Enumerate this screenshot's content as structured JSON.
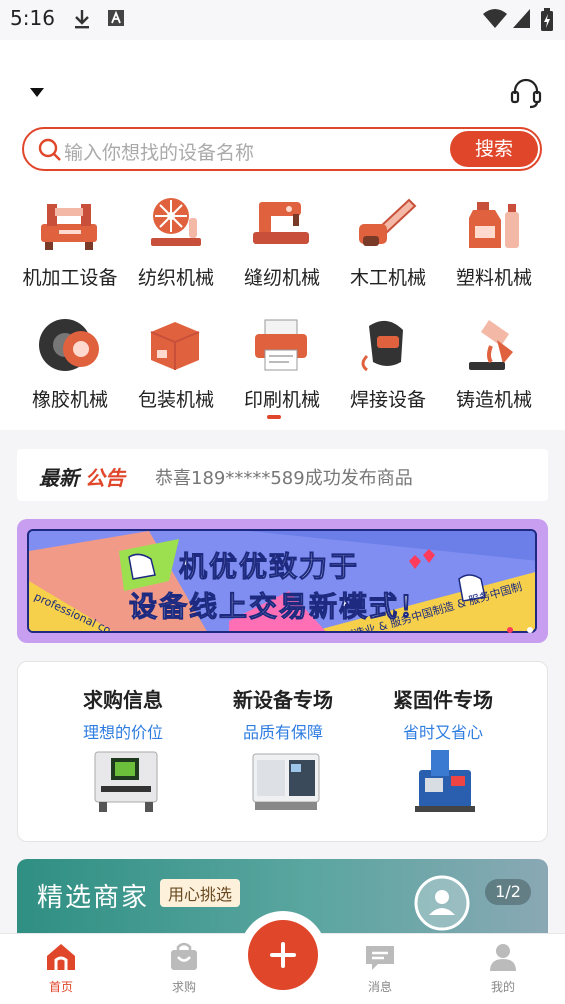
{
  "status_bar": {
    "time": "5:16"
  },
  "search": {
    "placeholder": "输入你想找的设备名称",
    "button_label": "搜索"
  },
  "categories": [
    {
      "label": "机加工设备",
      "icon": "lathe-icon"
    },
    {
      "label": "纺织机械",
      "icon": "textile-icon"
    },
    {
      "label": "缝纫机械",
      "icon": "sewing-machine-icon"
    },
    {
      "label": "木工机械",
      "icon": "chainsaw-icon"
    },
    {
      "label": "塑料机械",
      "icon": "plastic-bottles-icon"
    },
    {
      "label": "橡胶机械",
      "icon": "tire-icon"
    },
    {
      "label": "包装机械",
      "icon": "package-icon"
    },
    {
      "label": "印刷机械",
      "icon": "printer-icon"
    },
    {
      "label": "焊接设备",
      "icon": "welding-mask-icon"
    },
    {
      "label": "铸造机械",
      "icon": "casting-ladle-icon"
    }
  ],
  "notice": {
    "title_part1": "最新",
    "title_part2": "公告",
    "message": "恭喜189*****589成功发布商品"
  },
  "banner": {
    "line1": "机优优致力于",
    "line2": "设备线上交易新模式！",
    "side_text_left": "professional co",
    "side_text_right": "国制造业 & 服务中国制造 & 服务中国制"
  },
  "specials": [
    {
      "title": "求购信息",
      "subtitle": "理想的价位"
    },
    {
      "title": "新设备专场",
      "subtitle": "品质有保障"
    },
    {
      "title": "紧固件专场",
      "subtitle": "省时又省心"
    }
  ],
  "merchant": {
    "title": "精选商家",
    "tag": "用心挑选",
    "pager": "1/2"
  },
  "tabs": [
    {
      "label": "首页",
      "icon": "home-icon"
    },
    {
      "label": "求购",
      "icon": "shopping-bag-icon"
    },
    {
      "label": "消息",
      "icon": "message-icon"
    },
    {
      "label": "我的",
      "icon": "user-icon"
    }
  ],
  "colors": {
    "accent": "#e0462a",
    "link_blue": "#2f7de1",
    "banner_purple": "#c79ef0"
  }
}
